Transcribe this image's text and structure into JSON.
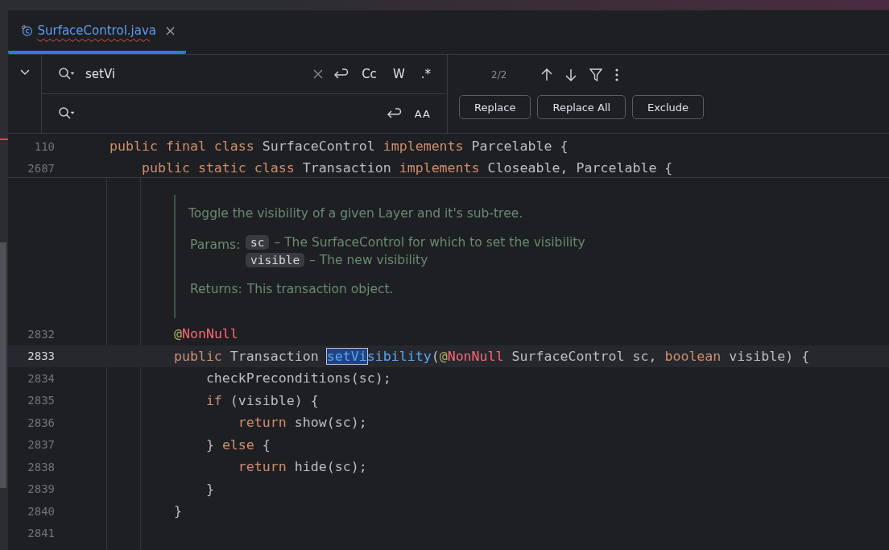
{
  "tab": {
    "label": "SurfaceControl.java",
    "selected": true,
    "error": true
  },
  "find": {
    "value": "setVi",
    "toggles": [
      {
        "label": "Cc",
        "selected": false
      },
      {
        "label": "W",
        "selected": false
      },
      {
        "label": ".*",
        "selected": false
      }
    ],
    "replace_toggles": [
      {
        "label": "AA",
        "selected": false
      }
    ],
    "count": "2/2",
    "buttons": [
      "Replace",
      "Replace All",
      "Exclude"
    ]
  },
  "sticky_lines": [
    {
      "number": "110",
      "tokens": [
        {
          "text": "public final class ",
          "kind": "keyword"
        },
        {
          "text": "SurfaceControl ",
          "kind": "plain"
        },
        {
          "text": "implements ",
          "kind": "keyword"
        },
        {
          "text": "Parcelable {",
          "kind": "plain"
        }
      ]
    },
    {
      "number": "2687",
      "tokens": [
        {
          "text": "    public static class ",
          "kind": "keyword"
        },
        {
          "text": "Transaction ",
          "kind": "plain"
        },
        {
          "text": "implements ",
          "kind": "keyword"
        },
        {
          "text": "Closeable, Parcelable {",
          "kind": "plain"
        }
      ]
    }
  ],
  "doc": {
    "summary": "Toggle the visibility of a given Layer and it's sub-tree.",
    "params_label": "Params:",
    "params": [
      {
        "name": "sc",
        "description": "– The SurfaceControl for which to set the visibility"
      },
      {
        "name": "visible",
        "description": "– The new visibility"
      }
    ],
    "returns_label": "Returns:",
    "returns": "This transaction object."
  },
  "lines": [
    {
      "number": "2832",
      "current": false,
      "tokens": [
        {
          "text": "        @",
          "kind": "at"
        },
        {
          "text": "NonNull",
          "kind": "annotation"
        }
      ]
    },
    {
      "number": "2833",
      "current": true,
      "tokens": [
        {
          "text": "        public ",
          "kind": "keyword"
        },
        {
          "text": "Transaction ",
          "kind": "plain"
        },
        {
          "text": "setVi",
          "kind": "match"
        },
        {
          "text": "sibility",
          "kind": "method"
        },
        {
          "text": "(",
          "kind": "plain"
        },
        {
          "text": "@",
          "kind": "at"
        },
        {
          "text": "NonNull ",
          "kind": "annotation"
        },
        {
          "text": "SurfaceControl sc, ",
          "kind": "plain"
        },
        {
          "text": "boolean ",
          "kind": "keyword"
        },
        {
          "text": "visible) {",
          "kind": "plain"
        }
      ]
    },
    {
      "number": "2834",
      "current": false,
      "tokens": [
        {
          "text": "            checkPreconditions(sc);",
          "kind": "plain"
        }
      ]
    },
    {
      "number": "2835",
      "current": false,
      "tokens": [
        {
          "text": "            if ",
          "kind": "keyword"
        },
        {
          "text": "(visible) {",
          "kind": "plain"
        }
      ]
    },
    {
      "number": "2836",
      "current": false,
      "tokens": [
        {
          "text": "                return ",
          "kind": "keyword"
        },
        {
          "text": "show(sc);",
          "kind": "plain"
        }
      ]
    },
    {
      "number": "2837",
      "current": false,
      "tokens": [
        {
          "text": "            } ",
          "kind": "plain"
        },
        {
          "text": "else ",
          "kind": "keyword"
        },
        {
          "text": "{",
          "kind": "plain"
        }
      ]
    },
    {
      "number": "2838",
      "current": false,
      "tokens": [
        {
          "text": "                return ",
          "kind": "keyword"
        },
        {
          "text": "hide(sc);",
          "kind": "plain"
        }
      ]
    },
    {
      "number": "2839",
      "current": false,
      "tokens": [
        {
          "text": "            }",
          "kind": "plain"
        }
      ]
    },
    {
      "number": "2840",
      "current": false,
      "tokens": [
        {
          "text": "        }",
          "kind": "plain"
        }
      ]
    },
    {
      "number": "2841",
      "current": false
    }
  ]
}
